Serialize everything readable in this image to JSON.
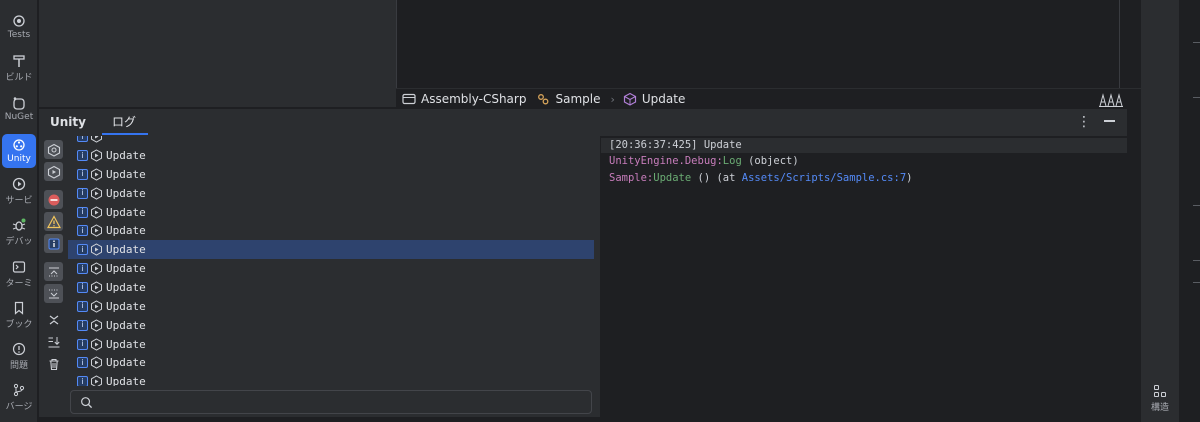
{
  "left_toolbar": {
    "items": [
      {
        "label": "Tests",
        "icon": "tests-icon"
      },
      {
        "label": "ビルド",
        "icon": "hammer-icon"
      },
      {
        "label": "NuGet",
        "icon": "nuget-icon"
      },
      {
        "label": "Unity",
        "icon": "unity-icon",
        "active": true
      },
      {
        "label": "サービ",
        "icon": "services-icon"
      },
      {
        "label": "デバッ",
        "icon": "debug-icon"
      },
      {
        "label": "ターミ",
        "icon": "terminal-icon"
      },
      {
        "label": "ブック",
        "icon": "bookmark-icon"
      },
      {
        "label": "問題",
        "icon": "problems-icon"
      },
      {
        "label": "バージ",
        "icon": "vcs-icon"
      }
    ]
  },
  "right_toolbar": {
    "structure_label": "構造"
  },
  "breadcrumb": {
    "items": [
      {
        "label": "Assembly-CSharp",
        "icon": "assembly-icon"
      },
      {
        "label": "Sample",
        "icon": "class-icon"
      },
      {
        "label": "Update",
        "icon": "method-icon"
      }
    ]
  },
  "tool_window": {
    "title": "Unity",
    "tabs": [
      {
        "label": "ログ",
        "active": true
      }
    ]
  },
  "log": {
    "rows": [
      {
        "text": "Update"
      },
      {
        "text": "Update"
      },
      {
        "text": "Update"
      },
      {
        "text": "Update"
      },
      {
        "text": "Update"
      },
      {
        "text": "Update",
        "selected": true
      },
      {
        "text": "Update"
      },
      {
        "text": "Update"
      },
      {
        "text": "Update"
      },
      {
        "text": "Update"
      },
      {
        "text": "Update"
      },
      {
        "text": "Update"
      },
      {
        "text": "Update"
      }
    ],
    "info_glyph": "i"
  },
  "search": {
    "placeholder": "",
    "value": ""
  },
  "details": {
    "header": "[20:36:37:425] Update",
    "line1": {
      "ns": "UnityEngine.Debug:",
      "method": "Log",
      "args": " (object)"
    },
    "line2": {
      "cls": "Sample:",
      "method": "Update",
      "mid": " () (at ",
      "path": "Assets/Scripts/Sample.cs:7",
      "end": ")"
    }
  },
  "colors": {
    "accent": "#3574f0",
    "selection": "#2e436e",
    "link": "#548af7",
    "purple": "#c77dbb",
    "green": "#6aab73"
  }
}
